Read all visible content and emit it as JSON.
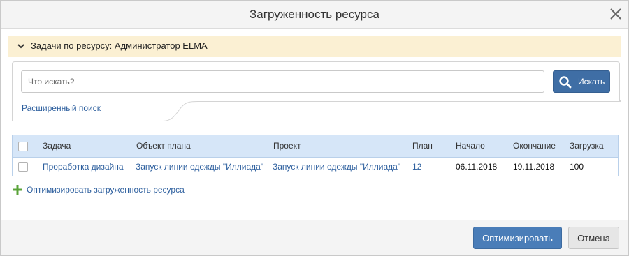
{
  "dialog": {
    "title": "Загруженность ресурса",
    "close_icon": "close-icon"
  },
  "section": {
    "label": "Задачи по ресурсу: Администратор ELMA",
    "icon": "chevron-down-icon"
  },
  "search": {
    "placeholder": "Что искать?",
    "value": "",
    "button_label": "Искать",
    "button_icon": "search-icon",
    "advanced_label": "Расширенный поиск"
  },
  "table": {
    "columns": [
      "Задача",
      "Объект плана",
      "Проект",
      "План",
      "Начало",
      "Окончание",
      "Загрузка"
    ],
    "rows": [
      {
        "task": "Проработка дизайна",
        "plan_object": "Запуск линии одежды \"Иллиада\"",
        "project": "Запуск линии одежды \"Иллиада\"",
        "plan": "12",
        "start": "06.11.2018",
        "end": "19.11.2018",
        "load": "100"
      }
    ]
  },
  "optimize_link": {
    "label": "Оптимизировать загруженность ресурса",
    "icon": "plus-icon"
  },
  "footer": {
    "primary_label": "Оптимизировать",
    "cancel_label": "Отмена"
  },
  "colors": {
    "accent": "#3f6ea5",
    "link": "#2d5f9e",
    "section_bg": "#fbf0d3",
    "grid_header_bg": "#d6e6f8",
    "plus_green": "#5aa339"
  }
}
